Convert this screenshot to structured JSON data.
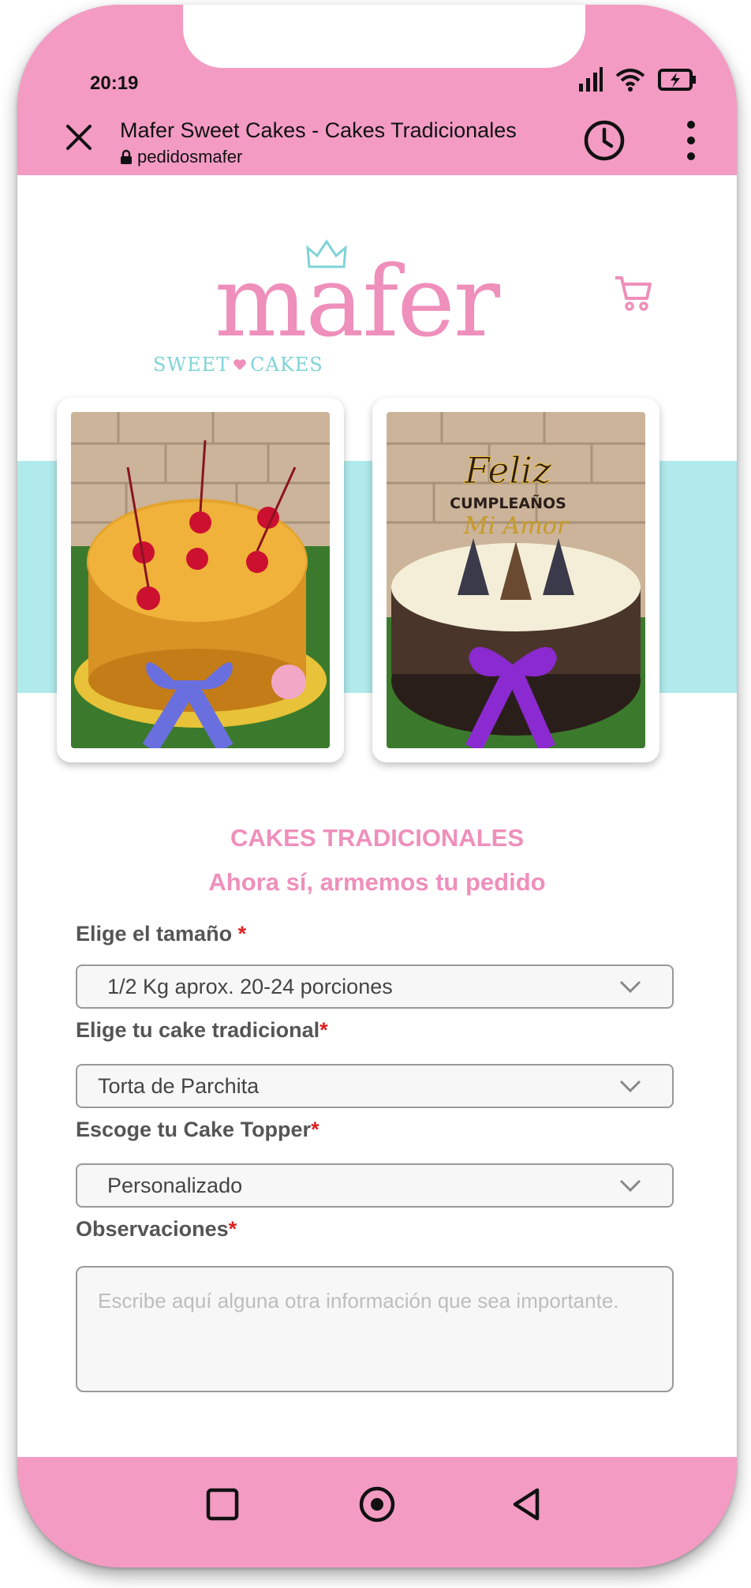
{
  "status_bar": {
    "time": "20:19",
    "icons": [
      "signal-icon",
      "wifi-icon",
      "battery-charging-icon"
    ]
  },
  "browser": {
    "page_title": "Mafer Sweet Cakes -  Cakes Tradicionales",
    "domain": "pedidosmafer",
    "icons": [
      "close-icon",
      "lock-icon",
      "history-icon",
      "more-vert-icon"
    ]
  },
  "logo": {
    "name": "mafer",
    "tagline_left": "SWEET",
    "tagline_right": "CAKES"
  },
  "gallery": {
    "images": [
      "pineapple upside-down cake with cherries and blue ribbon",
      "cake with Feliz Cumpleaños Mi Amor topper and purple ribbon"
    ],
    "topper_text": [
      "Feliz",
      "CUMPLEAÑOS",
      "Mi Amor"
    ]
  },
  "section": {
    "title": "CAKES TRADICIONALES",
    "subtitle": "Ahora sí, armemos tu pedido"
  },
  "form": {
    "size_label": "Elige el tamaño ",
    "size_value": "1/2 Kg aprox. 20-24 porciones",
    "cake_label": "Elige tu cake tradicional",
    "cake_value": "Torta de Parchita",
    "topper_label": "Escoge tu Cake Topper",
    "topper_value": "Personalizado",
    "notes_label": "Observaciones",
    "notes_placeholder": "Escribe aquí alguna otra información que sea importante.",
    "required_mark": "*"
  },
  "nav_bar": {
    "icons": [
      "recents-square-icon",
      "home-circle-icon",
      "back-triangle-icon"
    ]
  },
  "colors": {
    "brand_pink": "#f39bc3",
    "accent_teal": "#b0eaec",
    "required_red": "#e02020"
  }
}
